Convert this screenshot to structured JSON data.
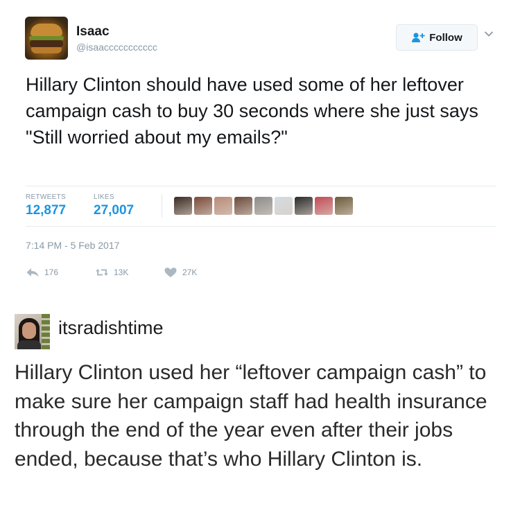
{
  "tweet": {
    "author": {
      "name": "Isaac",
      "handle": "@isaaccccccccccc",
      "avatar_icon": "burger-avatar-icon"
    },
    "follow_label": "Follow",
    "text": "Hillary Clinton should have used some of her leftover campaign cash to buy 30 seconds where she just says \"Still worried about my emails?\"",
    "stats": {
      "retweets_label": "RETWEETS",
      "retweets_value": "12,877",
      "likes_label": "LIKES",
      "likes_value": "27,007"
    },
    "liker_avatars": [
      "#3a2a22",
      "#7a4a3a",
      "#b98a78",
      "#6b4a3c",
      "#8c8c8c",
      "#d4dbe2",
      "#2a2a2a",
      "#c44a56",
      "#6c5a3a"
    ],
    "timestamp": "7:14 PM - 5 Feb 2017",
    "actions": {
      "replies": "176",
      "retweets": "13K",
      "likes": "27K"
    }
  },
  "reply": {
    "username": "itsradishtime",
    "text": "Hillary Clinton used her “leftover campaign cash” to make sure her campaign staff had health insurance through the end of the year even after their jobs ended, because that’s who Hillary Clinton is."
  },
  "colors": {
    "accent": "#1b95e0",
    "muted": "#8899a6",
    "text": "#14171a"
  }
}
